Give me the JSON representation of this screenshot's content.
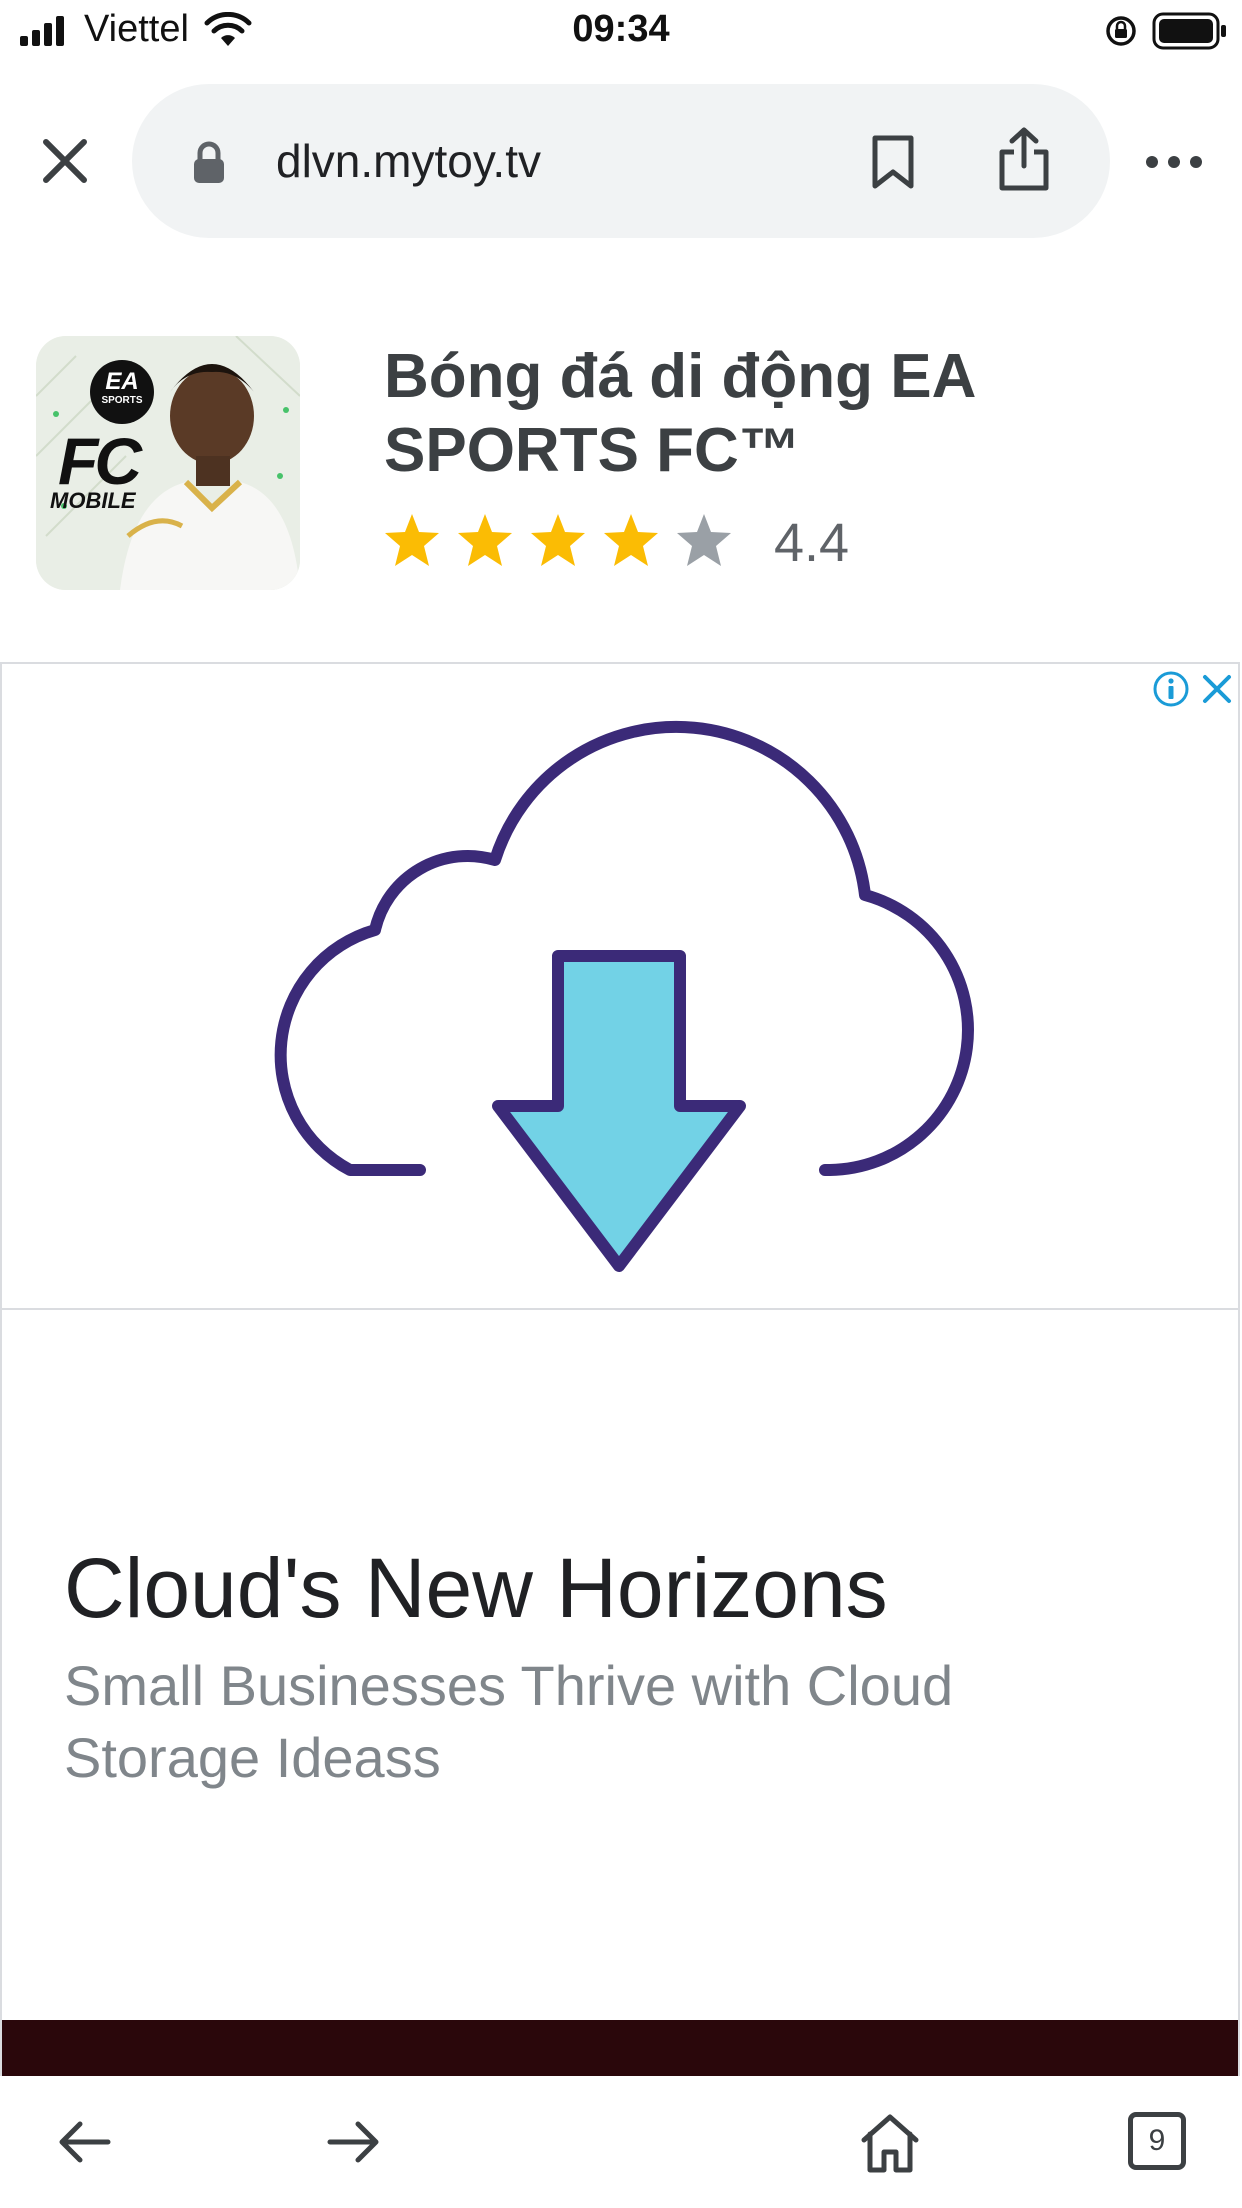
{
  "status_bar": {
    "carrier": "Viettel",
    "time": "09:34",
    "icons": [
      "signal-icon",
      "wifi-icon",
      "orientation-lock-icon",
      "battery-icon"
    ]
  },
  "browser": {
    "url": "dlvn.mytoy.tv",
    "icons": [
      "close-icon",
      "lock-icon",
      "bookmark-icon",
      "share-icon",
      "more-icon"
    ]
  },
  "app": {
    "title": "Bóng đá di động EA SPORTS FC™",
    "rating": "4.4",
    "rating_value": 4.4,
    "stars_max": 5,
    "icon_text": {
      "brand": "EA",
      "brand_sub": "SPORTS",
      "fc": "FC",
      "mobile": "MOBILE"
    }
  },
  "ad": {
    "headline": "Cloud's New Horizons",
    "body": "Small Businesses Thrive with Cloud Storage Ideass",
    "icons": [
      "ad-info-icon",
      "ad-close-icon",
      "cloud-download-icon"
    ],
    "colors": {
      "cloud_outline": "#3b2a78",
      "arrow_fill": "#72d2e6",
      "dark_strip": "#2a070b"
    }
  },
  "toolbar": {
    "tab_count": "9",
    "icons": [
      "back-arrow-icon",
      "forward-arrow-icon",
      "home-icon",
      "tabs-icon"
    ]
  },
  "colors": {
    "star": "#fbbc04",
    "star_empty": "#9aa0a6",
    "url_bar": "#f1f3f4"
  }
}
